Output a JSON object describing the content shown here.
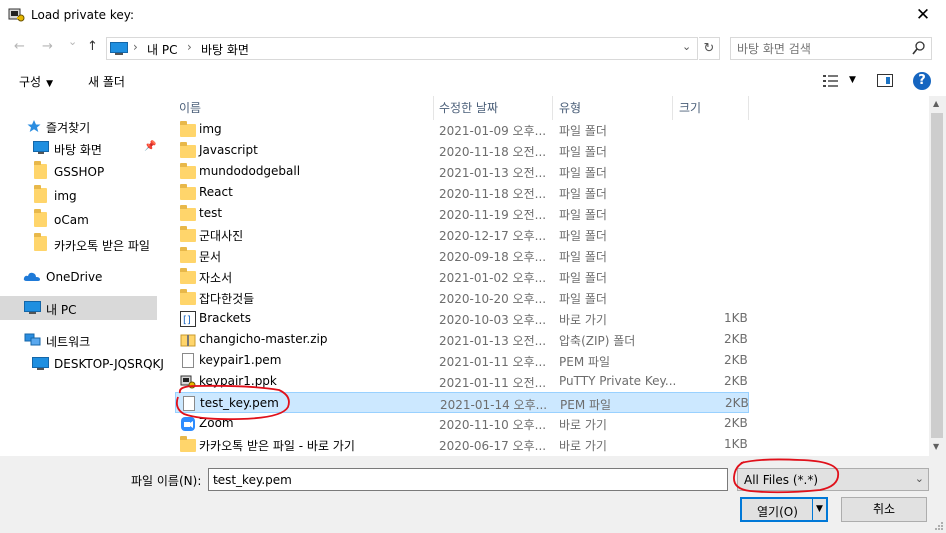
{
  "window": {
    "title": "Load private key:",
    "close_glyph": "✕"
  },
  "nav": {
    "back": "←",
    "forward": "→",
    "recent": "⌄",
    "up": "↑",
    "breadcrumb": [
      "내 PC",
      "바탕 화면"
    ],
    "refresh_glyph": "↻",
    "search_placeholder": "바탕 화면 검색"
  },
  "toolbar": {
    "organize": "구성",
    "new_folder": "새 폴더",
    "help": "?"
  },
  "sidebar": {
    "items": [
      {
        "label": "즐겨찾기",
        "icon": "star-icon"
      },
      {
        "label": "바탕 화면",
        "icon": "desktop-icon",
        "pinned": true
      },
      {
        "label": "GSSHOP",
        "icon": "folder-icon"
      },
      {
        "label": "img",
        "icon": "folder-icon"
      },
      {
        "label": "oCam",
        "icon": "folder-icon"
      },
      {
        "label": "카카오톡 받은 파일",
        "icon": "folder-icon"
      },
      {
        "label": "OneDrive",
        "icon": "cloud-icon"
      },
      {
        "label": "내 PC",
        "icon": "pc-icon",
        "selected": true
      },
      {
        "label": "네트워크",
        "icon": "network-icon"
      },
      {
        "label": "DESKTOP-JQSRQKJ",
        "icon": "computer-icon"
      }
    ]
  },
  "columns": {
    "name": "이름",
    "modified": "수정한 날짜",
    "type": "유형",
    "size": "크기"
  },
  "files": [
    {
      "name": "img",
      "date": "2021-01-09 오후...",
      "type": "파일 폴더",
      "size": "",
      "kind": "folder"
    },
    {
      "name": "Javascript",
      "date": "2020-11-18 오전...",
      "type": "파일 폴더",
      "size": "",
      "kind": "folder"
    },
    {
      "name": "mundododgeball",
      "date": "2021-01-13 오전...",
      "type": "파일 폴더",
      "size": "",
      "kind": "folder"
    },
    {
      "name": "React",
      "date": "2020-11-18 오전...",
      "type": "파일 폴더",
      "size": "",
      "kind": "folder"
    },
    {
      "name": "test",
      "date": "2020-11-19 오전...",
      "type": "파일 폴더",
      "size": "",
      "kind": "folder"
    },
    {
      "name": "군대사진",
      "date": "2020-12-17 오후...",
      "type": "파일 폴더",
      "size": "",
      "kind": "folder"
    },
    {
      "name": "문서",
      "date": "2020-09-18 오후...",
      "type": "파일 폴더",
      "size": "",
      "kind": "folder"
    },
    {
      "name": "자소서",
      "date": "2021-01-02 오후...",
      "type": "파일 폴더",
      "size": "",
      "kind": "folder"
    },
    {
      "name": "잡다한것들",
      "date": "2020-10-20 오후...",
      "type": "파일 폴더",
      "size": "",
      "kind": "folder"
    },
    {
      "name": "Brackets",
      "date": "2020-10-03 오후...",
      "type": "바로 가기",
      "size": "1KB",
      "kind": "brackets"
    },
    {
      "name": "changicho-master.zip",
      "date": "2021-01-13 오전...",
      "type": "압축(ZIP) 폴더",
      "size": "2KB",
      "kind": "zip"
    },
    {
      "name": "keypair1.pem",
      "date": "2021-01-11 오후...",
      "type": "PEM 파일",
      "size": "2KB",
      "kind": "file"
    },
    {
      "name": "keypair1.ppk",
      "date": "2021-01-11 오전...",
      "type": "PuTTY Private Key...",
      "size": "2KB",
      "kind": "putty"
    },
    {
      "name": "test_key.pem",
      "date": "2021-01-14 오후...",
      "type": "PEM 파일",
      "size": "2KB",
      "kind": "file",
      "selected": true
    },
    {
      "name": "Zoom",
      "date": "2020-11-10 오후...",
      "type": "바로 가기",
      "size": "2KB",
      "kind": "zoom"
    },
    {
      "name": "카카오톡 받은 파일 - 바로 가기",
      "date": "2020-06-17 오후...",
      "type": "바로 가기",
      "size": "1KB",
      "kind": "folder"
    }
  ],
  "footer": {
    "filename_label": "파일 이름(N):",
    "filename_value": "test_key.pem",
    "filter_value": "All Files (*.*)",
    "open_label": "열기(O)",
    "cancel_label": "취소"
  },
  "annotation_color": "#e0101a"
}
